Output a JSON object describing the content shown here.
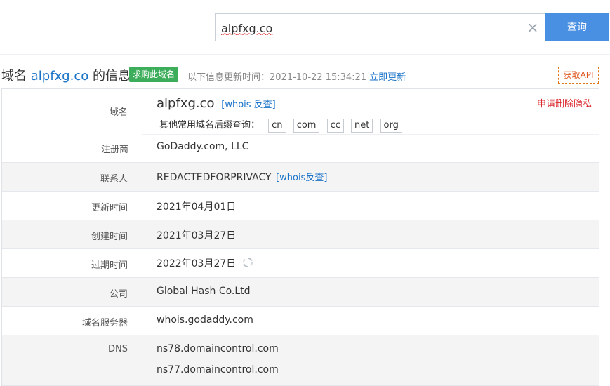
{
  "search": {
    "value": "alpfxg.co",
    "button_label": "查询"
  },
  "title": {
    "prefix": "域名 ",
    "domain": "alpfxg.co",
    "suffix": " 的信息",
    "buy_label": "求购此域名",
    "update_text": "以下信息更新时间：2021-10-22 15:34:21",
    "update_link": "立即更新",
    "api_label": "获取API"
  },
  "domain_row": {
    "label": "域名",
    "value": "alpfxg.co",
    "whois_link": "[whois 反查]",
    "remove_privacy": "申请删除隐私",
    "suffix_prompt": "其他常用域名后缀查询：",
    "suffixes": [
      "cn",
      "com",
      "cc",
      "net",
      "org"
    ]
  },
  "rows": {
    "registrar": {
      "label": "注册商",
      "value": "GoDaddy.com, LLC"
    },
    "contact": {
      "label": "联系人",
      "value": "REDACTEDFORPRIVACY",
      "link": "[whois反查]"
    },
    "updated": {
      "label": "更新时间",
      "value": "2021年04月01日"
    },
    "created": {
      "label": "创建时间",
      "value": "2021年03月27日"
    },
    "expires": {
      "label": "过期时间",
      "value": "2022年03月27日"
    },
    "company": {
      "label": "公司",
      "value": "Global Hash Co.Ltd"
    },
    "whois_server": {
      "label": "域名服务器",
      "value": "whois.godaddy.com"
    },
    "dns": {
      "label": "DNS",
      "values": [
        "ns78.domaincontrol.com",
        "ns77.domaincontrol.com"
      ]
    }
  },
  "colors": {
    "accent": "#4a90e2",
    "link": "#1a73c8",
    "buy": "#3cad5a",
    "danger": "#d9252a",
    "api": "#e0561f"
  }
}
